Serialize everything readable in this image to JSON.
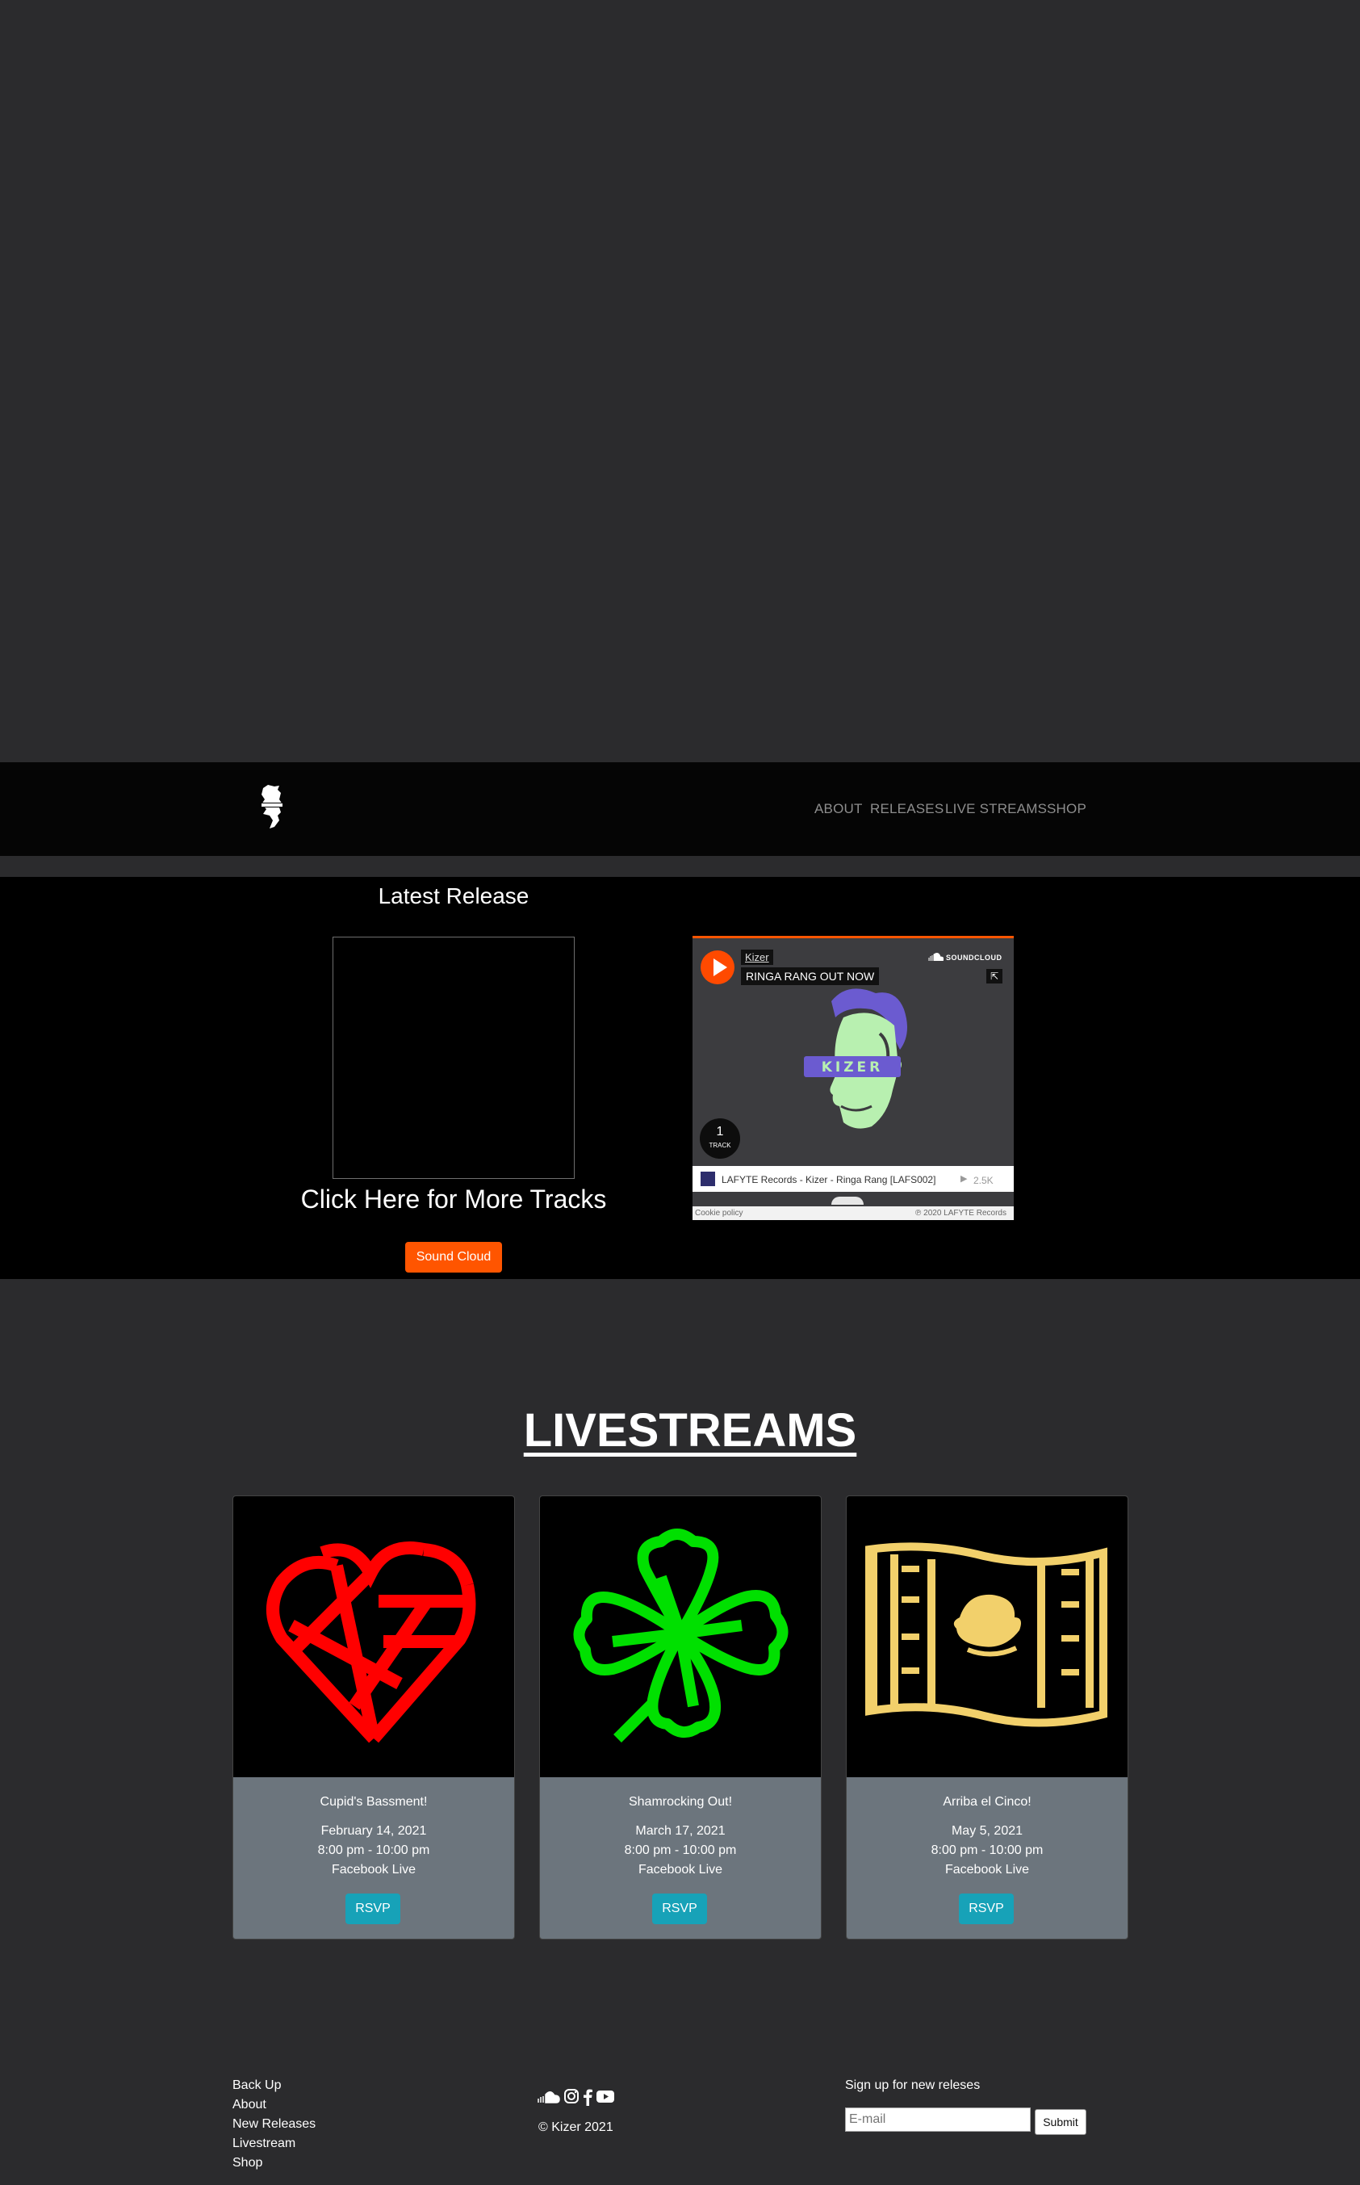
{
  "nav": {
    "links": [
      {
        "label": "ABOUT"
      },
      {
        "label": "RELEASES"
      },
      {
        "label": "LIVE STREAMS"
      },
      {
        "label": "SHOP"
      }
    ]
  },
  "release": {
    "title": "Latest Release",
    "more_tracks": "Click Here for More Tracks",
    "button_label": "Sound Cloud"
  },
  "soundcloud": {
    "artist": "Kizer",
    "track_title": "RINGA RANG OUT NOW",
    "brand": "SOUNDCLOUD",
    "track_count": "1",
    "track_count_label": "TRACK",
    "row_text": "LAFYTE Records - Kizer - Ringa Rang [LAFS002]",
    "plays": "2.5K",
    "cookie": "Cookie policy",
    "copyright": "℗ 2020 LAFYTE Records",
    "art_label": "KIZER",
    "colors": {
      "accent": "#ff5500",
      "art_purple": "#6b5bd0",
      "art_green": "#b8f0b0"
    }
  },
  "livestreams": {
    "title": "LIVESTREAMS",
    "cards": [
      {
        "title": "Cupid's Bassment!",
        "date": "February 14, 2021",
        "time": "8:00 pm - 10:00 pm",
        "venue": "Facebook Live",
        "button": "RSVP",
        "icon": "heart-icon",
        "color": "#ff0000"
      },
      {
        "title": "Shamrocking Out!",
        "date": "March 17, 2021",
        "time": "8:00 pm - 10:00 pm",
        "venue": "Facebook Live",
        "button": "RSVP",
        "icon": "clover-icon",
        "color": "#00e000"
      },
      {
        "title": "Arriba el Cinco!",
        "date": "May 5, 2021",
        "time": "8:00 pm - 10:00 pm",
        "venue": "Facebook Live",
        "button": "RSVP",
        "icon": "mexican-flag-icon",
        "color": "#f2d06b"
      }
    ]
  },
  "footer": {
    "links": [
      {
        "label": "Back Up"
      },
      {
        "label": "About"
      },
      {
        "label": "New Releases"
      },
      {
        "label": "Livestream"
      },
      {
        "label": "Shop"
      }
    ],
    "copyright": "© Kizer 2021",
    "signup_label": "Sign up for new releses",
    "email_placeholder": "E-mail",
    "submit_label": "Submit",
    "social_icons": [
      "soundcloud-icon",
      "instagram-icon",
      "facebook-icon",
      "youtube-icon"
    ]
  }
}
